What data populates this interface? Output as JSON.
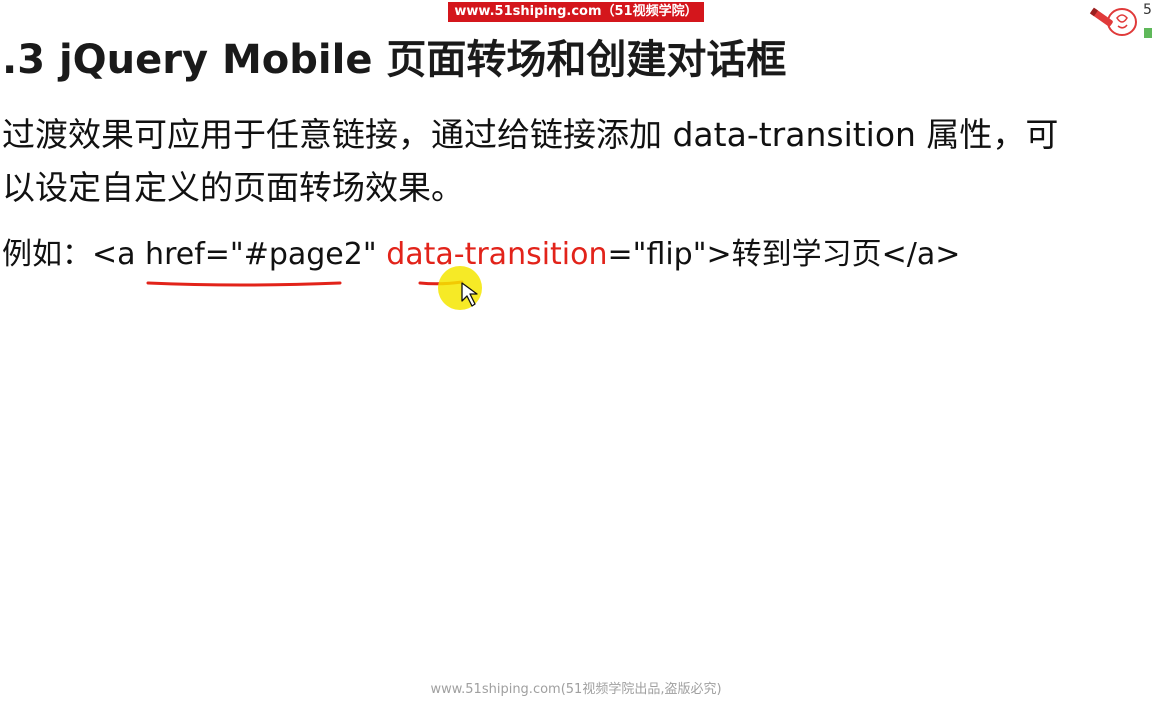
{
  "watermark": {
    "banner": "www.51shiping.com（51视频学院）",
    "corner_digit": "5",
    "footer": "www.51shiping.com(51视频学院出品,盗版必究)"
  },
  "slide": {
    "title": ".3 jQuery Mobile 页面转场和创建对话框",
    "paragraph": {
      "line1": "过渡效果可应用于任意链接，通过给链接添加 data-transition 属性，可",
      "line2": "以设定自定义的页面转场效果。"
    },
    "example": {
      "prefix": "例如：",
      "code_open": "<a href=\"#page2\" ",
      "code_attr": "data-transition",
      "code_rest": "=\"flip\">转到学习页</a>"
    }
  },
  "colors": {
    "highlight": "#e2231a",
    "banner_bg": "#d4161c",
    "cursor_halo": "#f5e600"
  },
  "icons": {
    "cursor": "pointer-cursor-icon",
    "logo": "pencil-cloud-logo-icon"
  }
}
